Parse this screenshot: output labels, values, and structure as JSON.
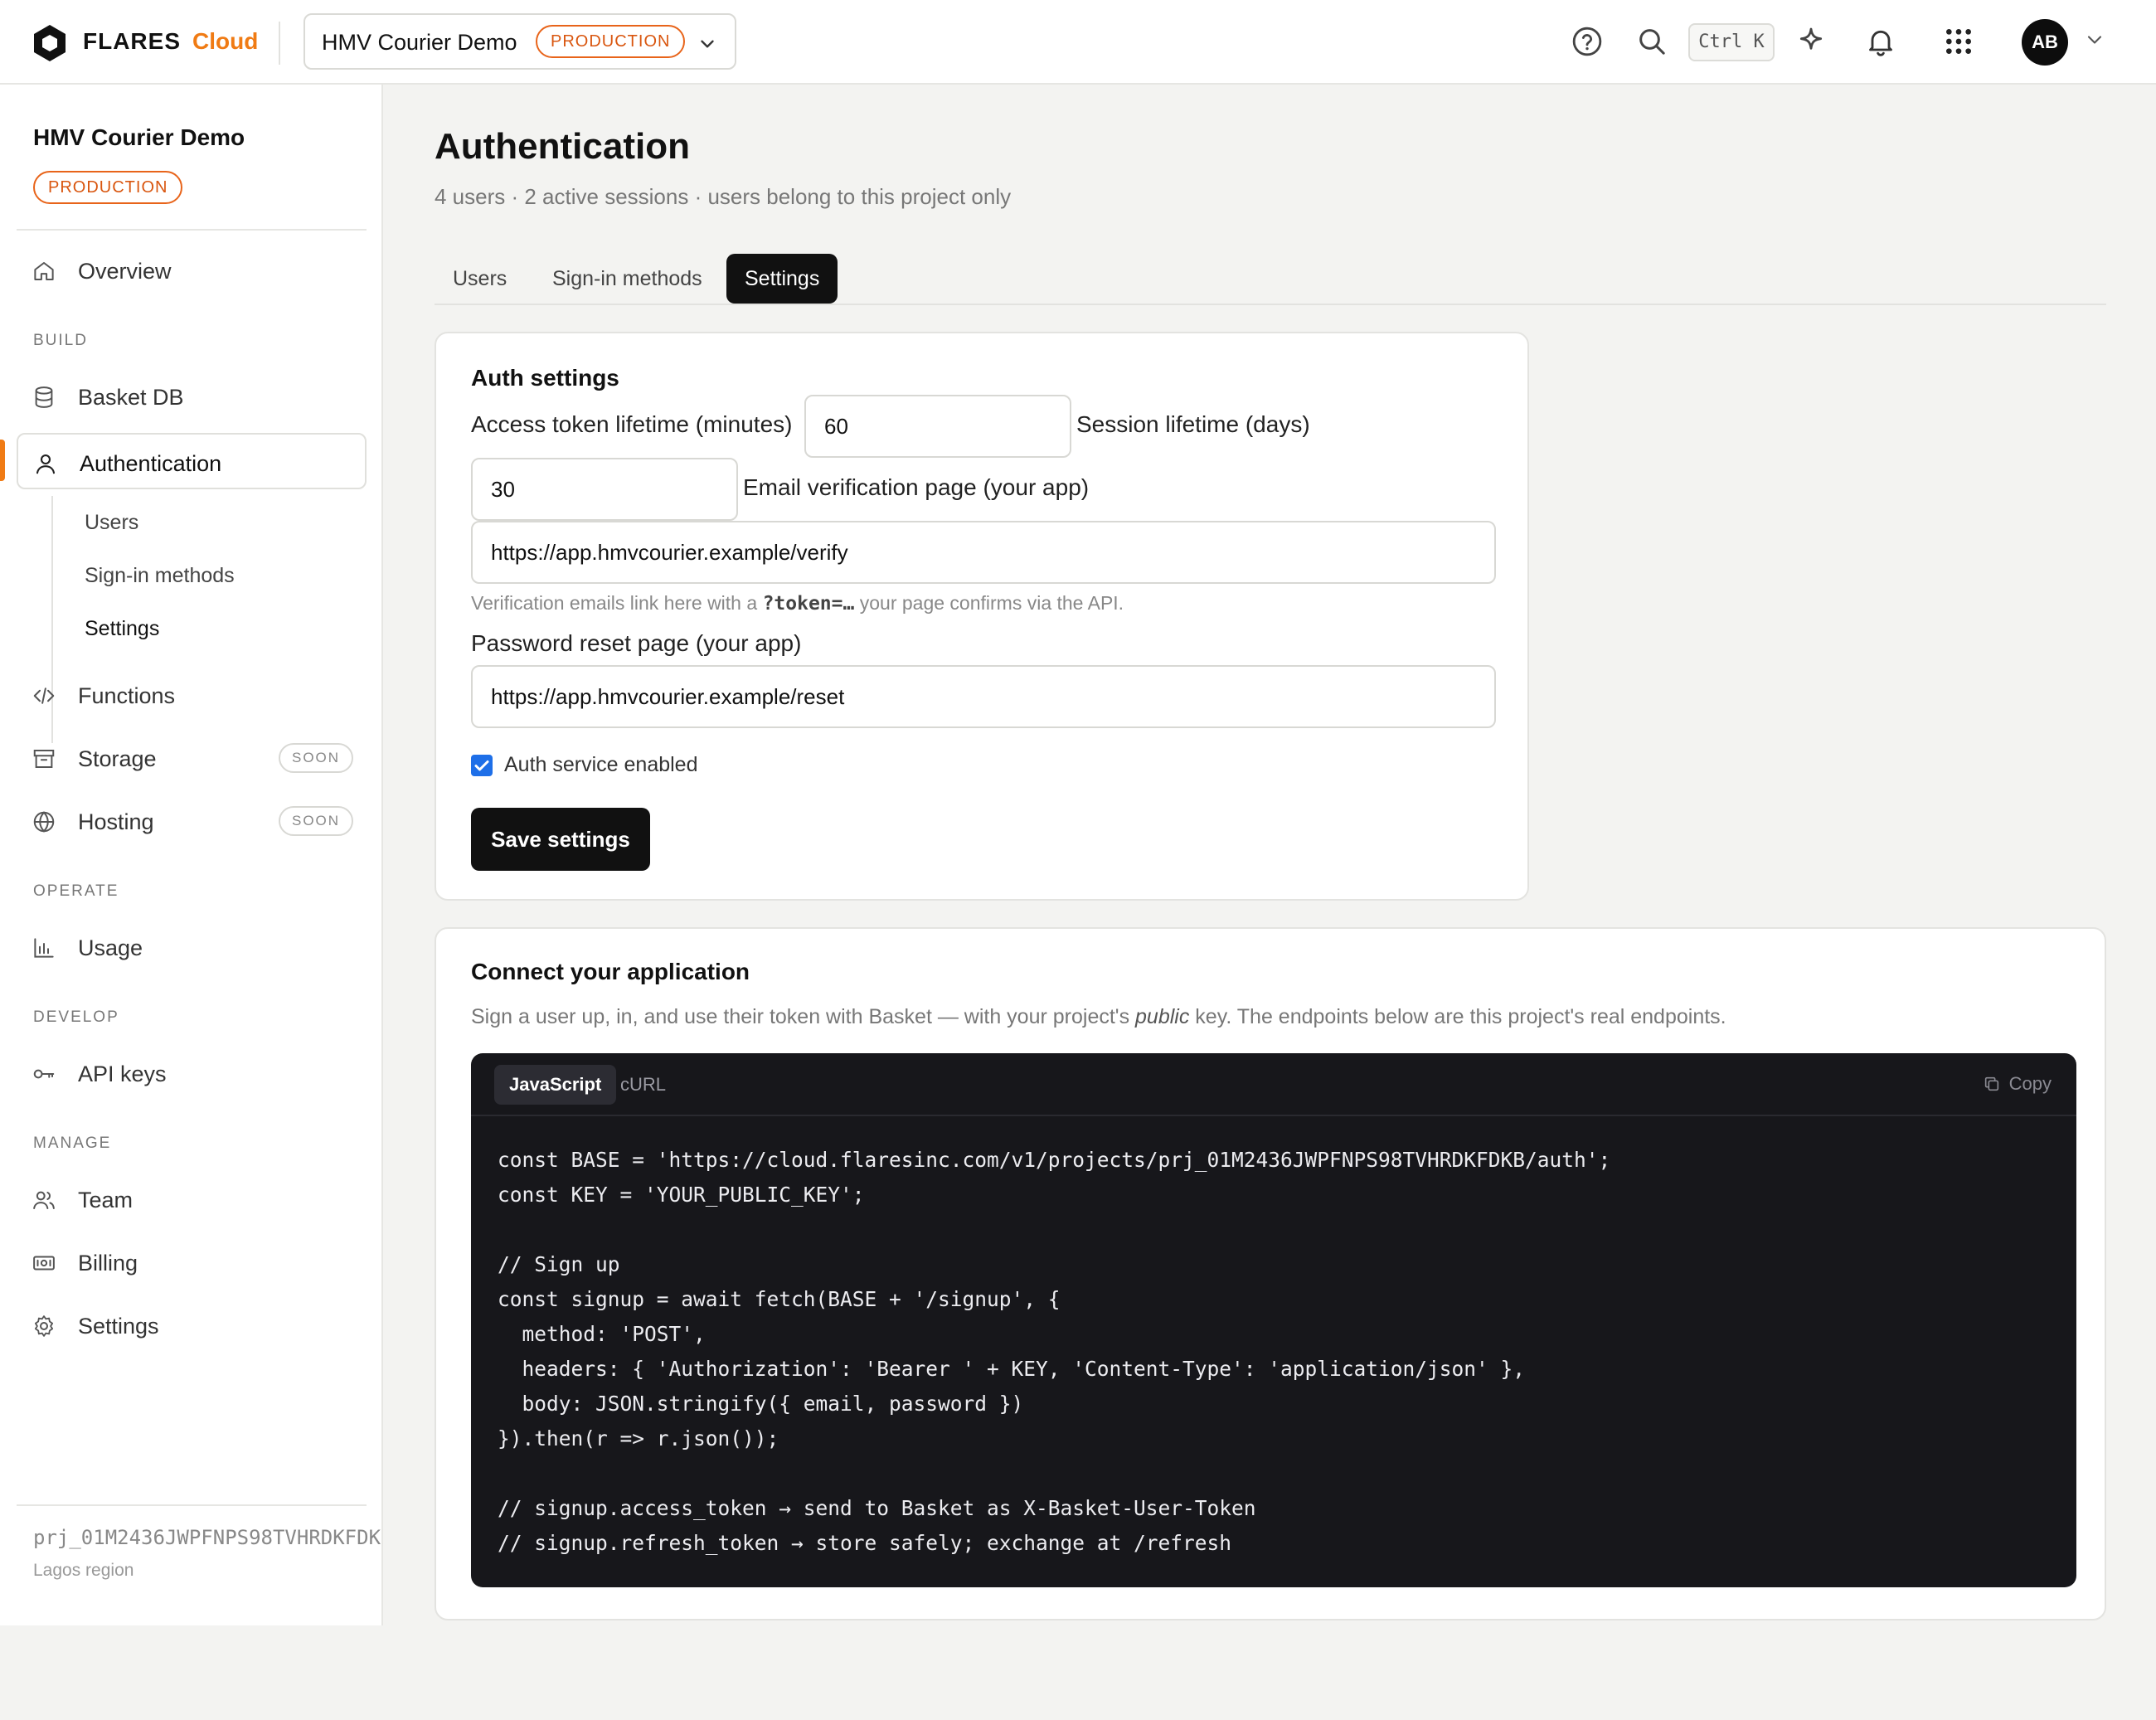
{
  "topbar": {
    "brand": "FLARES",
    "brand_suffix": "Cloud",
    "project_name": "HMV Courier Demo",
    "project_env": "PRODUCTION",
    "shortcut": "Ctrl K",
    "avatar_initials": "AB",
    "icons": [
      "help-icon",
      "search-icon",
      "sparkle-icon",
      "bell-icon",
      "grid-icon",
      "chevron-down-icon"
    ]
  },
  "sidebar": {
    "project_name": "HMV Courier Demo",
    "project_env": "PRODUCTION",
    "overview": "Overview",
    "sections": {
      "build": "BUILD",
      "operate": "OPERATE",
      "develop": "DEVELOP",
      "manage": "MANAGE"
    },
    "build_items": {
      "basket_db": "Basket DB",
      "authentication": "Authentication",
      "functions": "Functions",
      "storage": "Storage",
      "hosting": "Hosting"
    },
    "auth_subitems": [
      "Users",
      "Sign-in methods",
      "Settings"
    ],
    "soon_badge": "SOON",
    "operate_items": {
      "usage": "Usage"
    },
    "develop_items": {
      "api_keys": "API keys"
    },
    "manage_items": {
      "team": "Team",
      "billing": "Billing",
      "settings": "Settings"
    },
    "footer": {
      "project_id": "prj_01M2436JWPFNPS98TVHRDKFDK",
      "region": "Lagos region"
    }
  },
  "main": {
    "title": "Authentication",
    "subtitle": "4 users · 2 active sessions · users belong to this project only",
    "tabs": [
      "Users",
      "Sign-in methods",
      "Settings"
    ],
    "active_tab": "Settings",
    "auth_settings": {
      "title": "Auth settings",
      "access_token_label": "Access token lifetime (minutes)",
      "access_token_value": "60",
      "session_label": "Session lifetime (days)",
      "session_value": "30",
      "email_verify_label": "Email verification page (your app)",
      "email_verify_value": "https://app.hmvcourier.example/verify",
      "hint_before": "Verification emails link here with a ",
      "hint_code": "?token=…",
      "hint_after": " your page confirms via the API.",
      "password_reset_label": "Password reset page (your app)",
      "password_reset_value": "https://app.hmvcourier.example/reset",
      "enabled_label": "Auth service enabled",
      "enabled": true,
      "save_label": "Save settings"
    },
    "connect": {
      "title": "Connect your application",
      "desc_before": "Sign a user up, in, and use their token with Basket — with your project's ",
      "desc_em": "public",
      "desc_after": " key. The endpoints below are this project's real endpoints.",
      "code_tabs": [
        "JavaScript",
        "cURL"
      ],
      "active_code_tab": "JavaScript",
      "copy_label": "Copy",
      "code": "const BASE = 'https://cloud.flaresinc.com/v1/projects/prj_01M2436JWPFNPS98TVHRDKFDKB/auth';\nconst KEY = 'YOUR_PUBLIC_KEY';\n\n// Sign up\nconst signup = await fetch(BASE + '/signup', {\n  method: 'POST',\n  headers: { 'Authorization': 'Bearer ' + KEY, 'Content-Type': 'application/json' },\n  body: JSON.stringify({ email, password })\n}).then(r => r.json());\n\n// signup.access_token → send to Basket as X-Basket-User-Token\n// signup.refresh_token → store safely; exchange at /refresh"
    }
  },
  "colors": {
    "accent": "#f07b14",
    "badge": "#e8641a",
    "primary": "#111111",
    "checkbox": "#1e6fe8",
    "code_bg": "#17171b"
  }
}
